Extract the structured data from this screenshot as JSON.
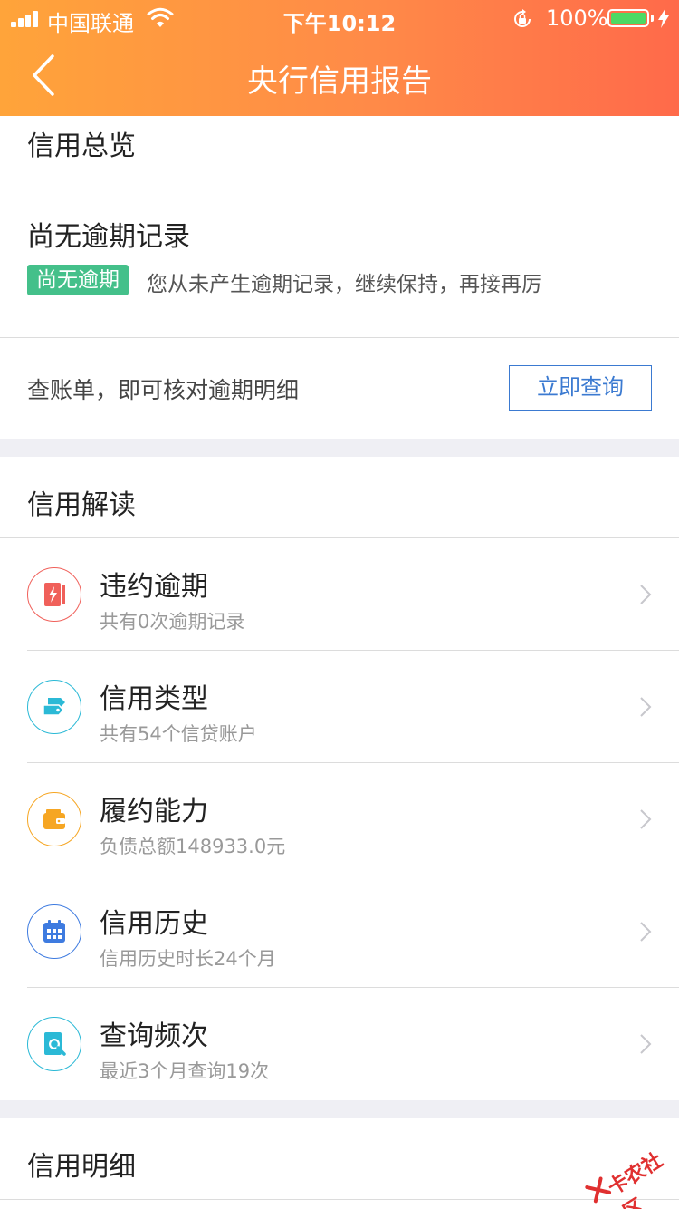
{
  "status_bar": {
    "carrier": "中国联通",
    "time": "下午10:12",
    "battery_percent": "100%",
    "battery_level": 1.0,
    "icons": [
      "signal-icon",
      "wifi-icon",
      "orientation-lock-icon",
      "battery-icon",
      "charging-bolt-icon"
    ]
  },
  "nav": {
    "title": "央行信用报告",
    "back_icon": "chevron-left-icon"
  },
  "overview": {
    "title": "信用总览",
    "record_title": "尚无逾期记录",
    "badge": "尚无逾期",
    "badge_desc": "您从未产生逾期记录，继续保持，再接再厉",
    "bill_text": "查账单，即可核对逾期明细",
    "query_button": "立即查询"
  },
  "interpretation": {
    "title": "信用解读",
    "items": [
      {
        "title": "违约逾期",
        "subtitle": "共有0次逾期记录",
        "icon": "alert-card-icon",
        "color": "#f0605a"
      },
      {
        "title": "信用类型",
        "subtitle": "共有54个信贷账户",
        "icon": "tag-card-icon",
        "color": "#2bb9d6"
      },
      {
        "title": "履约能力",
        "subtitle": "负债总额148933.0元",
        "icon": "wallet-icon",
        "color": "#f6a623"
      },
      {
        "title": "信用历史",
        "subtitle": "信用历史时长24个月",
        "icon": "calendar-icon",
        "color": "#3e7be0"
      },
      {
        "title": "查询频次",
        "subtitle": "最近3个月查询19次",
        "icon": "search-doc-icon",
        "color": "#2bb9d6"
      }
    ]
  },
  "detail": {
    "title": "信用明细"
  },
  "watermark": {
    "text": "卡农社区"
  },
  "colors": {
    "header_start": "#ffa43a",
    "header_end": "#ff6a4a",
    "badge_green": "#44c08a",
    "accent_blue": "#3b7ad1"
  }
}
